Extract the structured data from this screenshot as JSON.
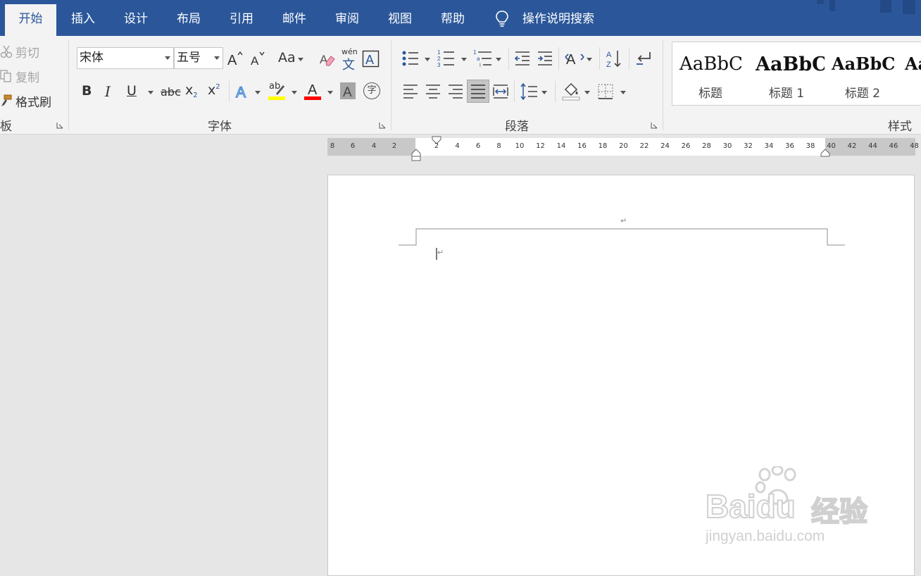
{
  "tabs": [
    {
      "label": "开始",
      "active": true
    },
    {
      "label": "插入"
    },
    {
      "label": "设计"
    },
    {
      "label": "布局"
    },
    {
      "label": "引用"
    },
    {
      "label": "邮件"
    },
    {
      "label": "审阅"
    },
    {
      "label": "视图"
    },
    {
      "label": "帮助"
    }
  ],
  "tell_me": {
    "label": "操作说明搜索",
    "icon": "lightbulb-icon"
  },
  "clipboard": {
    "cut": "剪切",
    "copy": "复制",
    "format_painter": "格式刷",
    "group_label": "板"
  },
  "font": {
    "name": "宋体",
    "size": "五号",
    "change_case": "Aa",
    "phonetic_top": "wén",
    "phonetic_bottom": "文",
    "enclose_char": "字",
    "bold": "B",
    "italic": "I",
    "underline": "U",
    "strikethrough": "abc",
    "subscript": "x",
    "superscript": "x",
    "subscript_mark": "2",
    "superscript_mark": "2",
    "highlight_label": "ab",
    "group_label": "字体",
    "highlight_color": "#ffff00",
    "font_color": "#ff0000"
  },
  "paragraph": {
    "group_label": "段落"
  },
  "styles": {
    "group_label": "样式",
    "items": [
      {
        "preview": "AaBbC",
        "name": "标题"
      },
      {
        "preview": "AaBbC",
        "name": "标题 1"
      },
      {
        "preview": "AaBbC",
        "name": "标题 2"
      },
      {
        "preview": "Aa",
        "name": ""
      }
    ]
  },
  "ruler": {
    "left_ticks": [
      "8",
      "6",
      "4",
      "2"
    ],
    "right_ticks": [
      "2",
      "4",
      "6",
      "8",
      "10",
      "12",
      "14",
      "16",
      "18",
      "20",
      "22",
      "24",
      "26",
      "28",
      "30",
      "32",
      "34",
      "36",
      "38",
      "40",
      "42",
      "44",
      "46",
      "48"
    ]
  },
  "document": {
    "paragraph_mark": "↵"
  },
  "watermark": {
    "brand": "Baidu",
    "cn": "经验",
    "url": "jingyan.baidu.com"
  },
  "colors": {
    "accent": "#2b579a",
    "ribbon": "#f3f3f3",
    "workspace": "#e6e6e6"
  }
}
